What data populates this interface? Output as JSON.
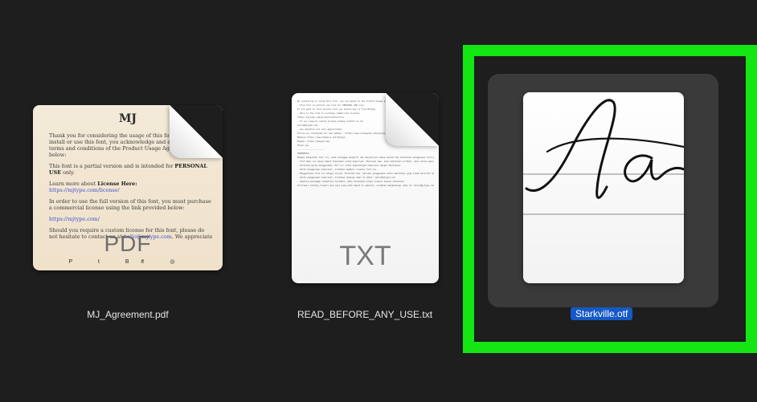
{
  "files": [
    {
      "name": "MJ_Agreement.pdf",
      "type_label": "PDF",
      "preview": {
        "logo": "MJ",
        "paragraph1": "Thank you for considering the usage of this font. If you want to install or use this font, you acknowledge and agree with the terms and conditions of the Product Usage Agreement stated below:",
        "paragraph2_prefix": "This font is a partial version and is intended for ",
        "paragraph2_emph": "PERSONAL USE",
        "paragraph2_suffix": " only.",
        "paragraph3_prefix": "Learn more about ",
        "paragraph3_emph": "License Here:",
        "link1": "https://mjtype.com/license/",
        "paragraph4": "In order to use the full version of this font, you must purchase a commercial license using the link provided below:",
        "link2": "https://mjtype.com/",
        "paragraph5_prefix": "Should you require a custom license for this font, please do not hesitate to contact us at ",
        "paragraph5_link": "hello@mjtype.com",
        "paragraph5_suffix": ". We appreciate",
        "social_icons": [
          "paypal-icon",
          "twitter-icon",
          "behance-icon",
          "instagram-icon"
        ],
        "social_glyphs": "P  t  Bē  ◎"
      }
    },
    {
      "name": "READ_BEFORE_ANY_USE.txt",
      "type_label": "TXT",
      "preview_lines": [
        "By installing or using this font, you are agree to the Product Usage Agreement:",
        "- This font is partial use free for PERSONAL USE only.",
        "If you want to find version font you should buy it from MJType.",
        "- Here is the link to purchase commercial license:",
        "https://mjtype.com/product/starkville",
        "- If you require custom license please contact us at:",
        "hello@mjtype.com",
        "- Any donation are very appreciated.",
        "Follow our Instagram for new update : https://www.instagram.com/mjtype.foundry/",
        "Behance https://www.behance.net/mjtype",
        "Paypal: https://paypal.me/",
        "Thank you.",
        "----------------------",
        "INDONESIA:",
        "Dengan mengunduh font ini, anda dianggap mengerti dan menyetujui semua syarat dan ketentuan penggunaan font dibawah ini:",
        "- Font demo ini hanya dapat digunakan untuk keperluan 'Personal Use' atau kebutuhan pribadi, atau untuk keperluan yang sifatnya tidak 'komersil', alias tidak menghasilkan profit atau keuntungan dari hasil memanfaatkan font ini.",
        "- Dilarang keras menggunakan font ini untuk kepentingan komersial apapun bentuknya.",
        "- Untuk penggunaan komersial, silahkan membeli lisensi font ini.",
        "- Menggunakan font ini dengan tujuan 'Personal Use' berlaku penggunaan untuk kebutuhan yang tidak bersifat komersial.",
        "- Untuk penggunaan komersial, silahkan hubungi kami di email: hello@mjtype.com",
        "- Apabila melanggar ketentuan tersebut, akan dikenakan biaya lisensi sesuai ketentuan.",
        "Informasi tentang lisensi apa saja yang anda dapat di website, silahkan menghubungi kami di: hello@mjtype.com"
      ]
    },
    {
      "name": "Starkville.otf",
      "preview_glyphs": "Aa",
      "selected": true
    }
  ],
  "colors": {
    "background": "#1e1e1e",
    "selection_outline": "#13e613",
    "selected_label_bg": "#1559c7"
  }
}
